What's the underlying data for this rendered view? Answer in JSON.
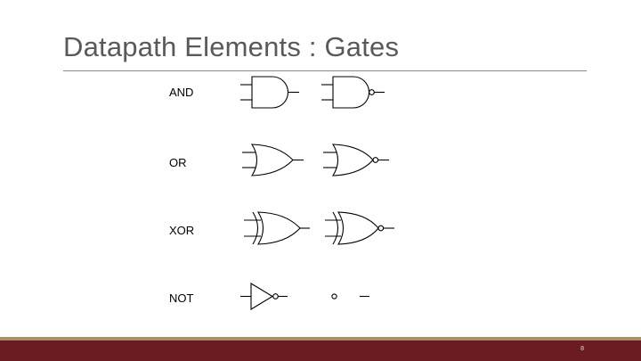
{
  "slide": {
    "title": "Datapath Elements : Gates",
    "page_number": "8"
  },
  "gates": [
    {
      "label": "AND",
      "symbols": [
        "and-gate-icon",
        "nand-gate-icon"
      ]
    },
    {
      "label": "OR",
      "symbols": [
        "or-gate-icon",
        "nor-gate-icon"
      ]
    },
    {
      "label": "XOR",
      "symbols": [
        "xor-gate-icon",
        "xnor-gate-icon"
      ]
    },
    {
      "label": "NOT",
      "symbols": [
        "not-gate-icon",
        "inversion-bubble-icon"
      ]
    }
  ],
  "colors": {
    "title": "#595959",
    "footer_band": "#6b1c22",
    "footer_accent": "#a8926a"
  }
}
